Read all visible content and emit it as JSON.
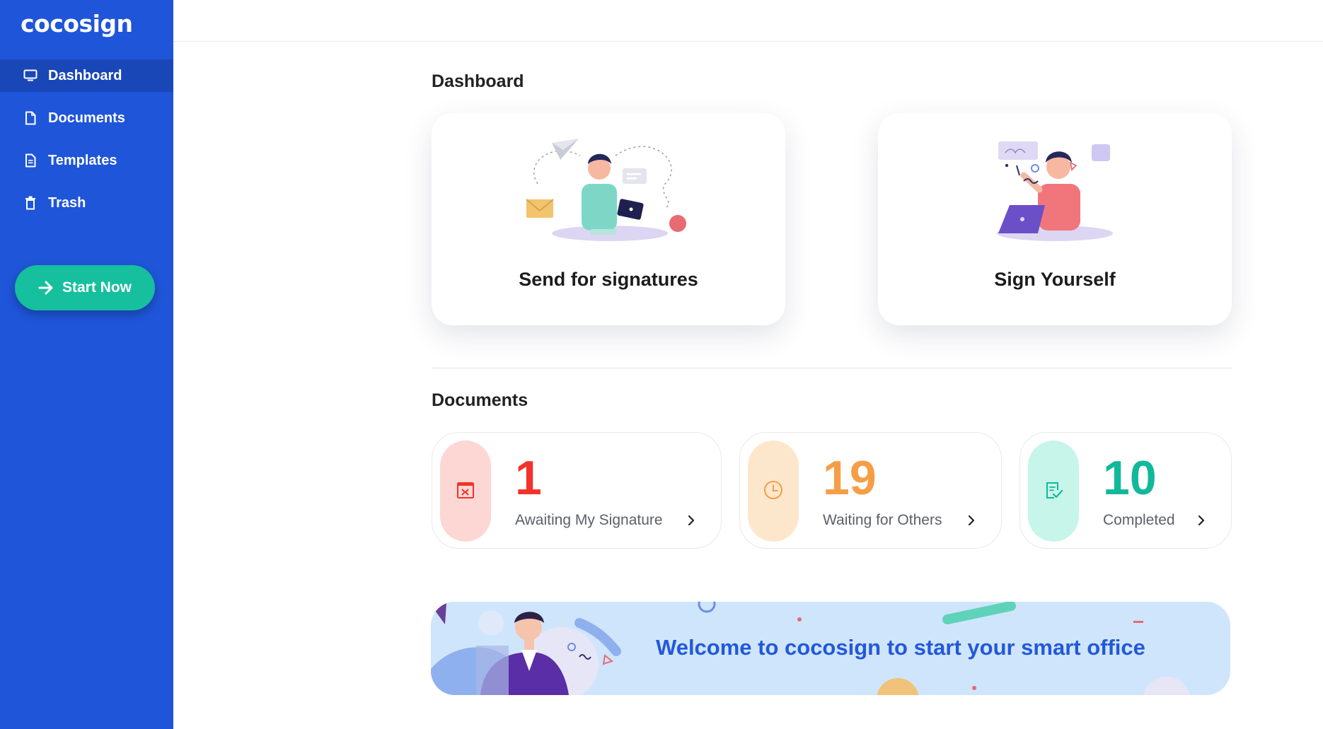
{
  "brand": {
    "logo": "cocosign"
  },
  "sidebar": {
    "items": [
      {
        "label": "Dashboard",
        "icon": "monitor-icon",
        "active": true
      },
      {
        "label": "Documents",
        "icon": "document-icon",
        "active": false
      },
      {
        "label": "Templates",
        "icon": "template-icon",
        "active": false
      },
      {
        "label": "Trash",
        "icon": "trash-icon",
        "active": false
      }
    ],
    "start_button": "Start Now"
  },
  "main": {
    "dashboard_title": "Dashboard",
    "cards": [
      {
        "label": "Send for signatures",
        "illustration": "person-with-tablet-illustration"
      },
      {
        "label": "Sign Yourself",
        "illustration": "person-signing-illustration"
      }
    ],
    "documents_title": "Documents",
    "stats": [
      {
        "value": "1",
        "label": "Awaiting My Signature",
        "icon": "signature-icon",
        "color": "#f2322b",
        "pill": "#fdd7d3"
      },
      {
        "value": "19",
        "label": "Waiting for Others",
        "icon": "clock-icon",
        "color": "#f59e45",
        "pill": "#fde7cc"
      },
      {
        "value": "10",
        "label": "Completed",
        "icon": "check-document-icon",
        "color": "#13b89a",
        "pill": "#c7f5ea"
      }
    ],
    "banner": {
      "text": "Welcome to cocosign to start your smart office"
    }
  },
  "colors": {
    "sidebar": "#1f55d9",
    "accent_green": "#16bf9d",
    "banner_bg": "#cfe5fb",
    "banner_text": "#2358d9"
  }
}
